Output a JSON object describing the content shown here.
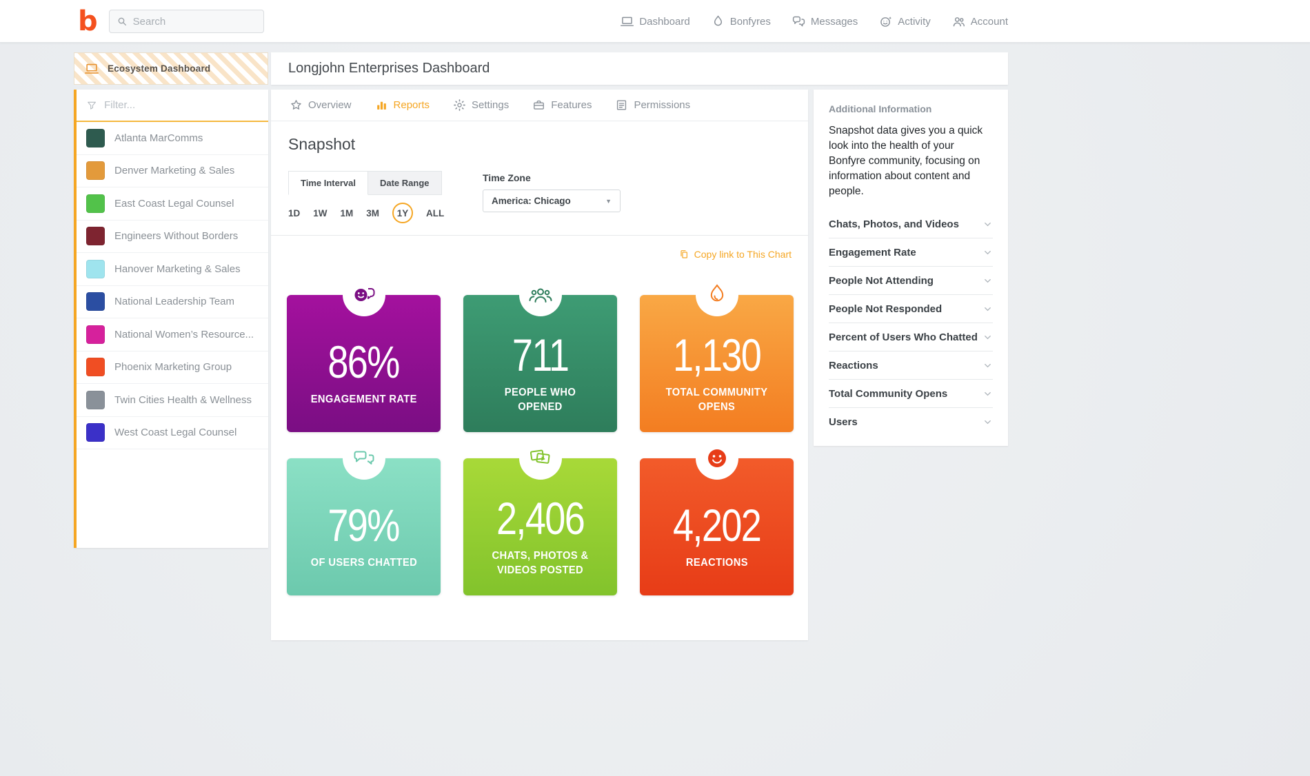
{
  "colors": {
    "accent": "#F5A623",
    "logo": "#F4511E"
  },
  "topbar": {
    "logo_text": "b",
    "search": {
      "placeholder": "Search"
    },
    "nav": [
      {
        "label": "Dashboard",
        "icon": "laptop-icon"
      },
      {
        "label": "Bonfyres",
        "icon": "flame-icon"
      },
      {
        "label": "Messages",
        "icon": "chat-bubbles-icon"
      },
      {
        "label": "Activity",
        "icon": "smiley-sparkle-icon"
      },
      {
        "label": "Account",
        "icon": "people-icon"
      }
    ]
  },
  "sidebar": {
    "header_label": "Ecosystem Dashboard",
    "filter_placeholder": "Filter...",
    "items": [
      {
        "label": "Atlanta MarComms",
        "color": "#2E5B4F"
      },
      {
        "label": "Denver Marketing & Sales",
        "color": "#E39A3B"
      },
      {
        "label": "East Coast Legal Counsel",
        "color": "#52C24A"
      },
      {
        "label": "Engineers Without Borders",
        "color": "#7E2430"
      },
      {
        "label": "Hanover Marketing & Sales",
        "color": "#9FE4EE"
      },
      {
        "label": "National Leadership Team",
        "color": "#2B4EA2"
      },
      {
        "label": "National Women’s Resource...",
        "color": "#D6219C"
      },
      {
        "label": "Phoenix Marketing Group",
        "color": "#F04E23"
      },
      {
        "label": "Twin Cities Health & Wellness",
        "color": "#8A9199"
      },
      {
        "label": "West Coast Legal Counsel",
        "color": "#3B30C8"
      }
    ]
  },
  "main": {
    "title": "Longjohn Enterprises Dashboard",
    "tabs": [
      {
        "label": "Overview",
        "active": false
      },
      {
        "label": "Reports",
        "active": true
      },
      {
        "label": "Settings",
        "active": false
      },
      {
        "label": "Features",
        "active": false
      },
      {
        "label": "Permissions",
        "active": false
      }
    ],
    "section_title": "Snapshot",
    "range_tabs": [
      {
        "label": "Time Interval",
        "active": true
      },
      {
        "label": "Date Range",
        "active": false
      }
    ],
    "intervals": [
      {
        "label": "1D",
        "selected": false
      },
      {
        "label": "1W",
        "selected": false
      },
      {
        "label": "1M",
        "selected": false
      },
      {
        "label": "3M",
        "selected": false
      },
      {
        "label": "1Y",
        "selected": true
      },
      {
        "label": "ALL",
        "selected": false
      }
    ],
    "timezone": {
      "label": "Time Zone",
      "value": "America: Chicago"
    },
    "copy_link_label": "Copy link to This Chart",
    "metrics": {
      "cards": [
        {
          "value": "86%",
          "label": "ENGAGEMENT RATE",
          "color_top": "#A4119E",
          "color_bottom": "#7A0E83",
          "icon": "chat-smiley-icon"
        },
        {
          "value": "711",
          "label": "PEOPLE WHO OPENED",
          "color_top": "#3E9C74",
          "color_bottom": "#2E7D5B",
          "icon": "people-group-icon"
        },
        {
          "value": "1,130",
          "label": "TOTAL COMMUNITY OPENS",
          "color_top": "#F9A845",
          "color_bottom": "#F37D21",
          "icon": "flame-icon"
        },
        {
          "value": "79%",
          "label": "OF USERS CHATTED",
          "color_top": "#8BE0C5",
          "color_bottom": "#6CC9AD",
          "icon": "chat-bubbles-icon"
        },
        {
          "value": "2,406",
          "label": "CHATS, PHOTOS & VIDEOS POSTED",
          "color_top": "#A8D938",
          "color_bottom": "#82C32C",
          "icon": "photos-icon"
        },
        {
          "value": "4,202",
          "label": "REACTIONS",
          "color_top": "#F25B2A",
          "color_bottom": "#E73C17",
          "icon": "smiley-icon"
        }
      ]
    }
  },
  "info_panel": {
    "title": "Additional Information",
    "description": "Snapshot data gives you a quick look into the health of your Bonfyre community, focusing on information about content and people.",
    "items": [
      {
        "label": "Chats, Photos, and Videos"
      },
      {
        "label": "Engagement Rate"
      },
      {
        "label": "People Not Attending"
      },
      {
        "label": "People Not Responded"
      },
      {
        "label": "Percent of Users Who Chatted"
      },
      {
        "label": "Reactions"
      },
      {
        "label": "Total Community Opens"
      },
      {
        "label": "Users"
      }
    ]
  }
}
